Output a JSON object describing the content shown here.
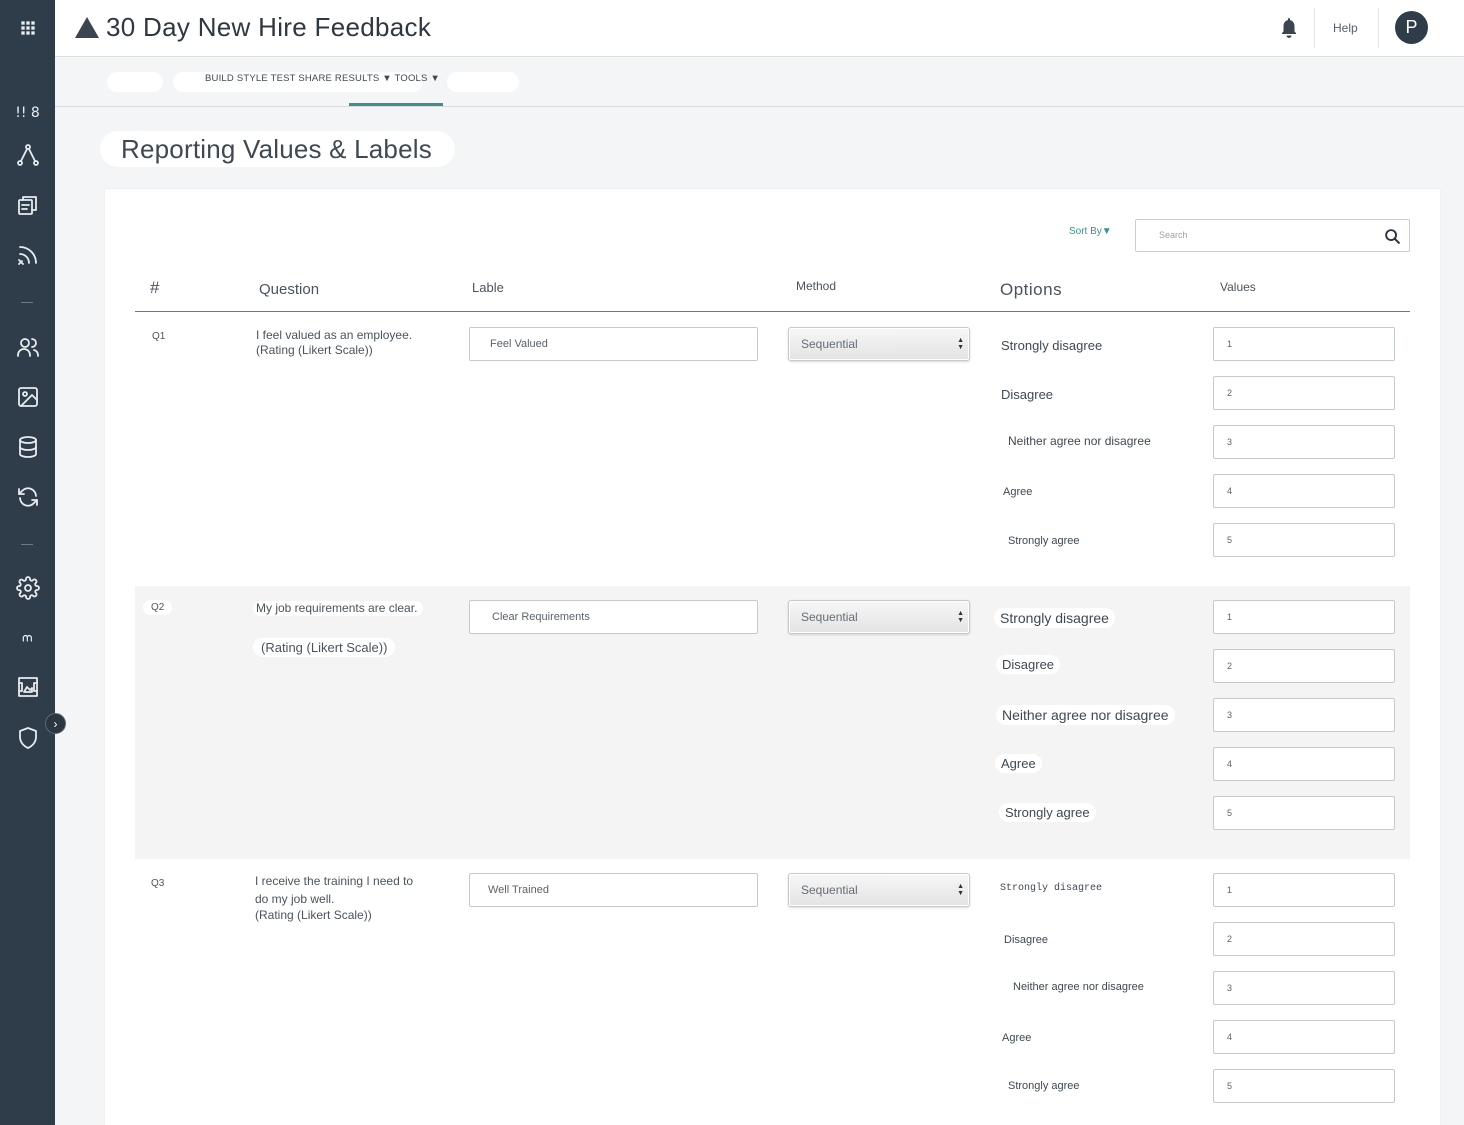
{
  "app": {
    "title": "30 Day New Hire Feedback",
    "help_label": "Help",
    "avatar_initial": "P",
    "accent_color": "#3f8f8c",
    "sidebar_color": "#2f3d4a"
  },
  "sidebar": {
    "badge_text": "!! 8",
    "items": [
      {
        "icon": "apps-grid-icon"
      },
      {
        "icon": "connections-icon"
      },
      {
        "icon": "surveys-icon"
      },
      {
        "icon": "distribution-icon"
      },
      {
        "icon": "contacts-icon"
      },
      {
        "icon": "image-library-icon"
      },
      {
        "icon": "database-icon"
      },
      {
        "icon": "sync-icon"
      },
      {
        "icon": "settings-gear-icon"
      },
      {
        "icon": "integrations-icon"
      },
      {
        "icon": "image-frame-icon"
      },
      {
        "icon": "security-shield-icon"
      },
      {
        "icon": "expand-chevron-icon"
      }
    ]
  },
  "subnav": {
    "text": "BUILD STYLE TEST SHARE RESULTS ▼ TOOLS ▼"
  },
  "page": {
    "title": "Reporting Values & Labels"
  },
  "toolbar": {
    "sort_label": "Sort By",
    "sort_caret": "▼",
    "search_placeholder": "Search"
  },
  "table": {
    "headers": {
      "num": "#",
      "question": "Question",
      "label": "Lable",
      "method": "Method",
      "options": "Options",
      "values": "Values"
    },
    "rows": [
      {
        "num": "Q1",
        "question_line1": "I feel valued as an employee.",
        "question_line2": "(Rating (Likert Scale))",
        "label": "Feel Valued",
        "method": "Sequential",
        "options": [
          "Strongly disagree",
          "Disagree",
          "Neither agree nor disagree",
          "Agree",
          "Strongly agree"
        ],
        "values": [
          "1",
          "2",
          "3",
          "4",
          "5"
        ]
      },
      {
        "num": "Q2",
        "question_line1": "My job requirements are clear.",
        "question_line2": "(Rating (Likert Scale))",
        "label": "Clear Requirements",
        "method": "Sequential",
        "options": [
          "Strongly disagree",
          "Disagree",
          "Neither agree nor disagree",
          "Agree",
          "Strongly agree"
        ],
        "values": [
          "1",
          "2",
          "3",
          "4",
          "5"
        ]
      },
      {
        "num": "Q3",
        "question_line1": "I receive the training I need to do my job well.",
        "question_line2": "(Rating (Likert Scale))",
        "label": "Well Trained",
        "method": "Sequential",
        "options": [
          "Strongly disagree",
          "Disagree",
          "Neither agree nor disagree",
          "Agree",
          "Strongly agree"
        ],
        "values": [
          "1",
          "2",
          "3",
          "4",
          "5"
        ]
      }
    ]
  }
}
